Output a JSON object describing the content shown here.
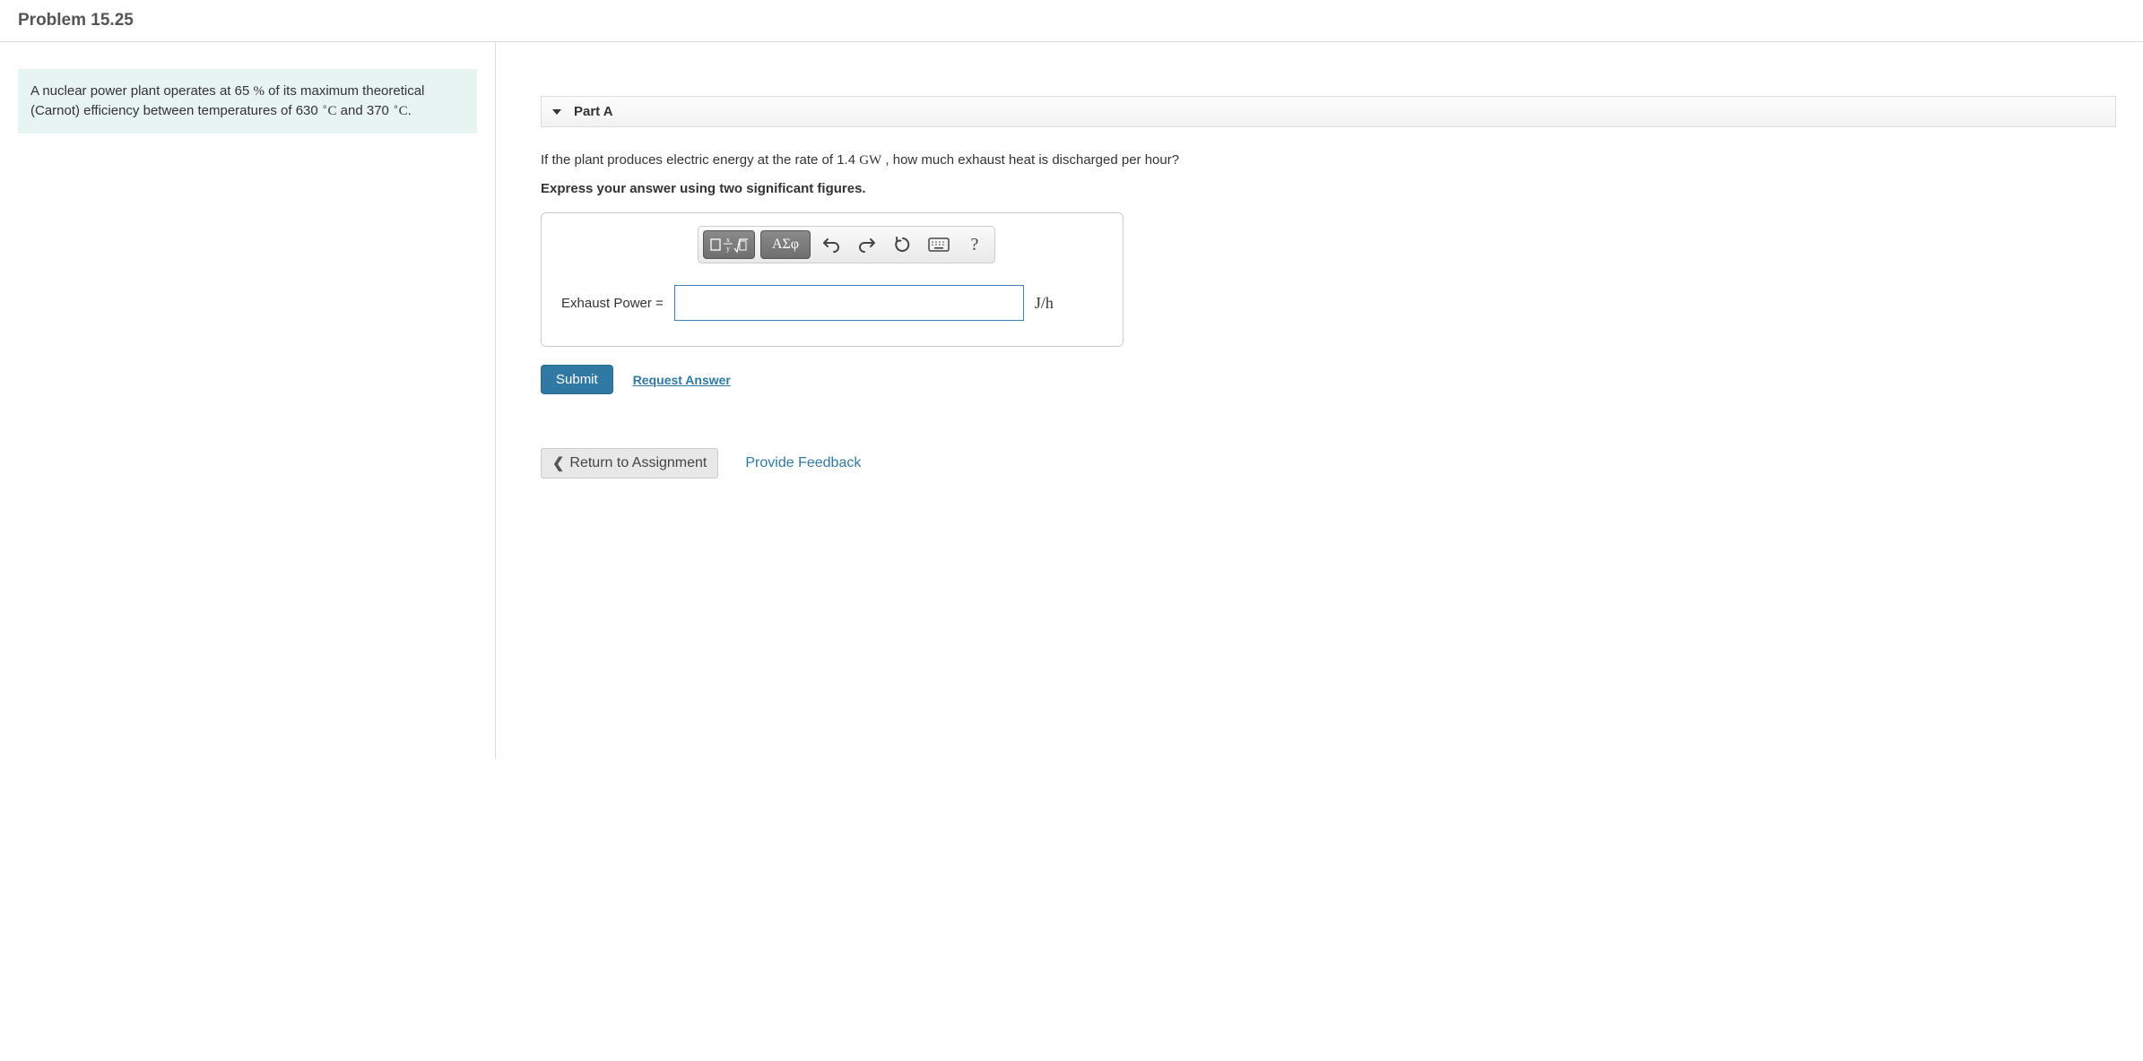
{
  "header": {
    "title": "Problem 15.25"
  },
  "problem": {
    "statement_html": "A nuclear power plant operates at 65 <span class='serif'>%</span> of its maximum theoretical (Carnot) efficiency between temperatures of 630 <span class='serif'><sup>∘</sup>C</span> and 370 <span class='serif'><sup>∘</sup>C</span>."
  },
  "part": {
    "label": "Part A",
    "question_html": "If the plant produces electric energy at the rate of 1.4 <span class='serif'>GW</span> , how much exhaust heat is discharged per hour?",
    "instruction": "Express your answer using two significant figures.",
    "answer_label": "Exhaust Power =",
    "unit_html": "J/h",
    "toolbar": {
      "greek": "ΑΣφ"
    }
  },
  "actions": {
    "submit": "Submit",
    "request": "Request Answer",
    "return": "Return to Assignment",
    "feedback": "Provide Feedback"
  }
}
